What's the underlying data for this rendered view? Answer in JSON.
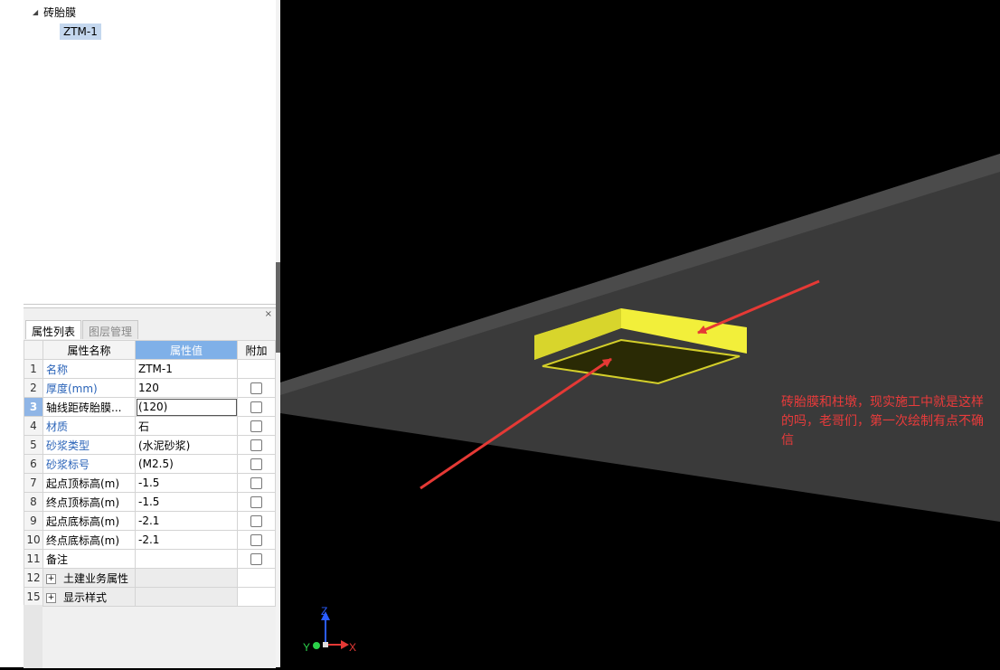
{
  "tree": {
    "root_label": "砖胎膜",
    "child_label": "ZTM-1"
  },
  "panel": {
    "close_glyph": "×",
    "tabs": [
      "属性列表",
      "图层管理"
    ],
    "columns": {
      "name": "属性名称",
      "value": "属性值",
      "extra": "附加"
    },
    "rows": [
      {
        "num": "1",
        "name": "名称",
        "value": "ZTM-1"
      },
      {
        "num": "2",
        "name": "厚度(mm)",
        "value": "120"
      },
      {
        "num": "3",
        "name": "轴线距砖胎膜...",
        "value": "(120)"
      },
      {
        "num": "4",
        "name": "材质",
        "value": "石"
      },
      {
        "num": "5",
        "name": "砂浆类型",
        "value": "(水泥砂浆)"
      },
      {
        "num": "6",
        "name": "砂浆标号",
        "value": "(M2.5)"
      },
      {
        "num": "7",
        "name": "起点顶标高(m)",
        "value": "-1.5"
      },
      {
        "num": "8",
        "name": "终点顶标高(m)",
        "value": "-1.5"
      },
      {
        "num": "9",
        "name": "起点底标高(m)",
        "value": "-2.1"
      },
      {
        "num": "10",
        "name": "终点底标高(m)",
        "value": "-2.1"
      },
      {
        "num": "11",
        "name": "备注",
        "value": ""
      }
    ],
    "groups": [
      {
        "num": "12",
        "expand": "+",
        "name": "土建业务属性"
      },
      {
        "num": "15",
        "expand": "+",
        "name": "显示样式"
      }
    ]
  },
  "viewport": {
    "annotation": "砖胎膜和柱墩，现实施工中就是这样的吗，老哥们，第一次绘制有点不确信",
    "axes": {
      "z": "Z",
      "y": "Y",
      "x": "X"
    },
    "colors": {
      "slab": "#3a3a3a",
      "block_top": "#f2ef3a",
      "block_side": "#c9c623",
      "arrow": "#e53935",
      "annotation_text": "#e83b3b",
      "selected_header": "#7fb0e8"
    }
  }
}
